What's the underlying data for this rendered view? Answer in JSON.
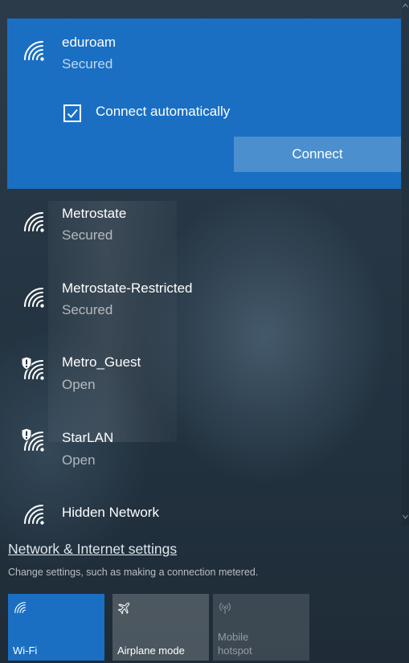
{
  "networks": [
    {
      "name": "eduroam",
      "status": "Secured",
      "icon": "wifi-secured-icon"
    },
    {
      "name": "Metrostate",
      "status": "Secured",
      "icon": "wifi-secured-icon"
    },
    {
      "name": "Metrostate-Restricted",
      "status": "Secured",
      "icon": "wifi-secured-icon"
    },
    {
      "name": "Metro_Guest",
      "status": "Open",
      "icon": "wifi-open-shield-icon"
    },
    {
      "name": "StarLAN",
      "status": "Open",
      "icon": "wifi-open-shield-icon"
    },
    {
      "name": "Hidden Network",
      "status": "",
      "icon": "wifi-icon"
    }
  ],
  "selected_network": {
    "connect_automatically_label": "Connect automatically",
    "connect_automatically_checked": true,
    "connect_button_label": "Connect"
  },
  "settings": {
    "link_label": "Network & Internet settings",
    "description": "Change settings, such as making a connection metered."
  },
  "quick_actions": [
    {
      "label": "Wi-Fi",
      "icon": "wifi-icon",
      "active": true
    },
    {
      "label": "Airplane mode",
      "icon": "airplane-icon",
      "active": false
    },
    {
      "label": "Mobile hotspot",
      "line1": "Mobile",
      "line2": "hotspot",
      "icon": "hotspot-icon",
      "active": false,
      "disabled": true
    }
  ],
  "colors": {
    "accent": "#1a6fc3",
    "button": "#4c8fcf",
    "background": "#263644"
  }
}
